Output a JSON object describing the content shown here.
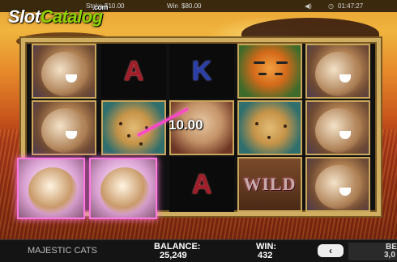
{
  "topbar": {
    "stake_label": "Stake",
    "stake_value": "$10.00",
    "win_label": "Win",
    "win_value": "$80.00",
    "time": "01:47:27"
  },
  "watermark": {
    "slot": "Slot",
    "catalog": "Catalog",
    "com": ".com"
  },
  "reels": [
    [
      "lion",
      "lion",
      "lion-highlight"
    ],
    [
      "A",
      "cheetah",
      "lion-highlight"
    ],
    [
      "K",
      "puma",
      "A"
    ],
    [
      "tiger",
      "cheetah",
      "WILD"
    ],
    [
      "lion",
      "lion",
      "lion"
    ]
  ],
  "symbols": {
    "A": "A",
    "K": "K",
    "wild": "WILD"
  },
  "win_popup": "10.00",
  "bottom": {
    "game_name": "MAJESTIC CATS",
    "balance_label": "BALANCE:",
    "balance_value": "25,249",
    "win_label": "WIN:",
    "win_value": "432",
    "back_icon": "‹",
    "bet_label": "BE",
    "bet_value": "3,0"
  },
  "colors": {
    "win_line": "#ff44cc",
    "frame": "#cfae62"
  }
}
